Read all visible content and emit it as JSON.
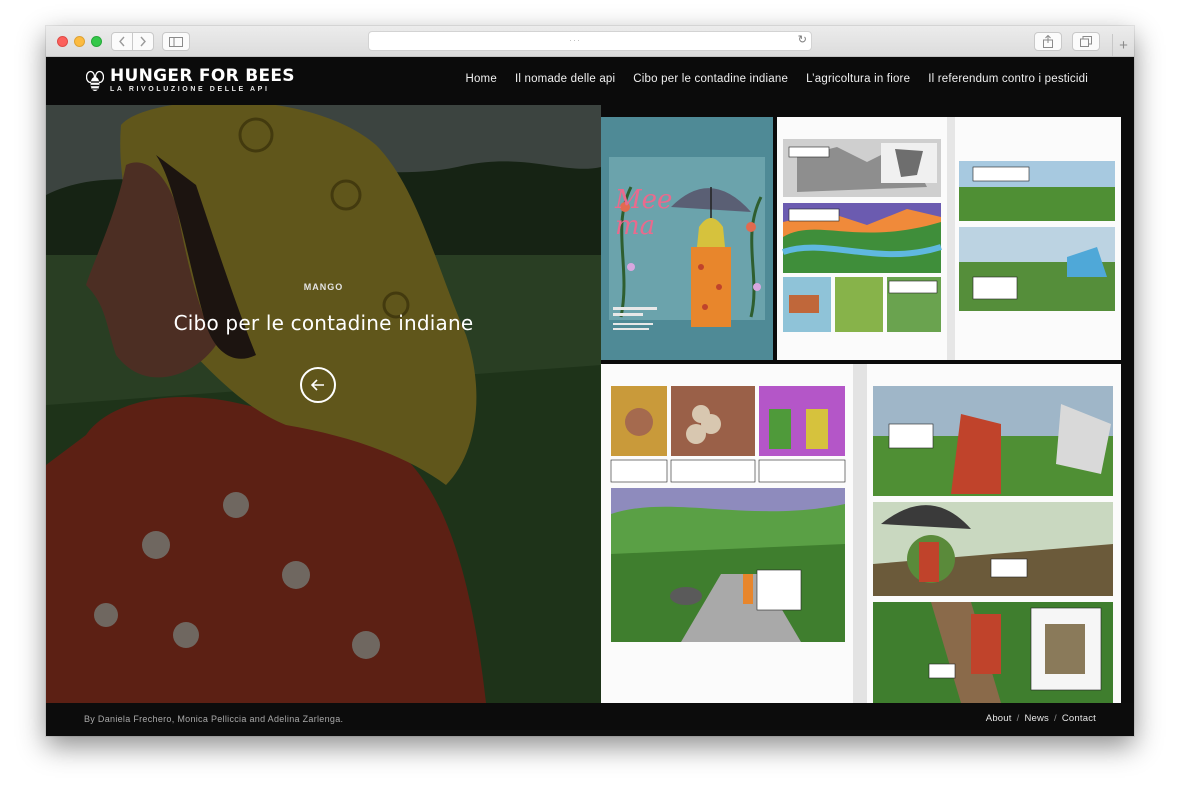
{
  "browser": {
    "icons": {
      "back": "chevron-left-icon",
      "forward": "chevron-right-icon",
      "sidebar": "sidebar-icon",
      "reload": "reload-icon",
      "share": "share-icon",
      "tabs": "tabs-icon",
      "new_tab": "plus-icon"
    },
    "reload_glyph": "↻",
    "new_tab_glyph": "+"
  },
  "header": {
    "logo": {
      "title": "HUNGER FOR BEES",
      "subtitle": "LA RIVOLUZIONE DELLE API",
      "icon": "bee-icon"
    },
    "nav": [
      {
        "label": "Home"
      },
      {
        "label": "Il nomade delle api"
      },
      {
        "label": "Cibo per le contadine indiane"
      },
      {
        "label": "L’agricoltura in fiore"
      },
      {
        "label": "Il referendum contro i pesticidi"
      }
    ]
  },
  "hero": {
    "category": "MANGO",
    "title": "Cibo per le contadine indiane",
    "back_icon": "arrow-left-icon"
  },
  "gallery": {
    "cover_title": "Mee ma"
  },
  "footer": {
    "credits": "By Daniela Frechero, Monica Pelliccia and Adelina Zarlenga.",
    "links": [
      {
        "label": "About"
      },
      {
        "label": "News"
      },
      {
        "label": "Contact"
      }
    ],
    "separator": "/"
  },
  "colors": {
    "header_bg": "#0b0b0b",
    "scarf_yellow": "#c9b53a",
    "dress_red": "#c0432b",
    "cover_teal": "#4f8a96",
    "field_green": "#4f8f34"
  }
}
